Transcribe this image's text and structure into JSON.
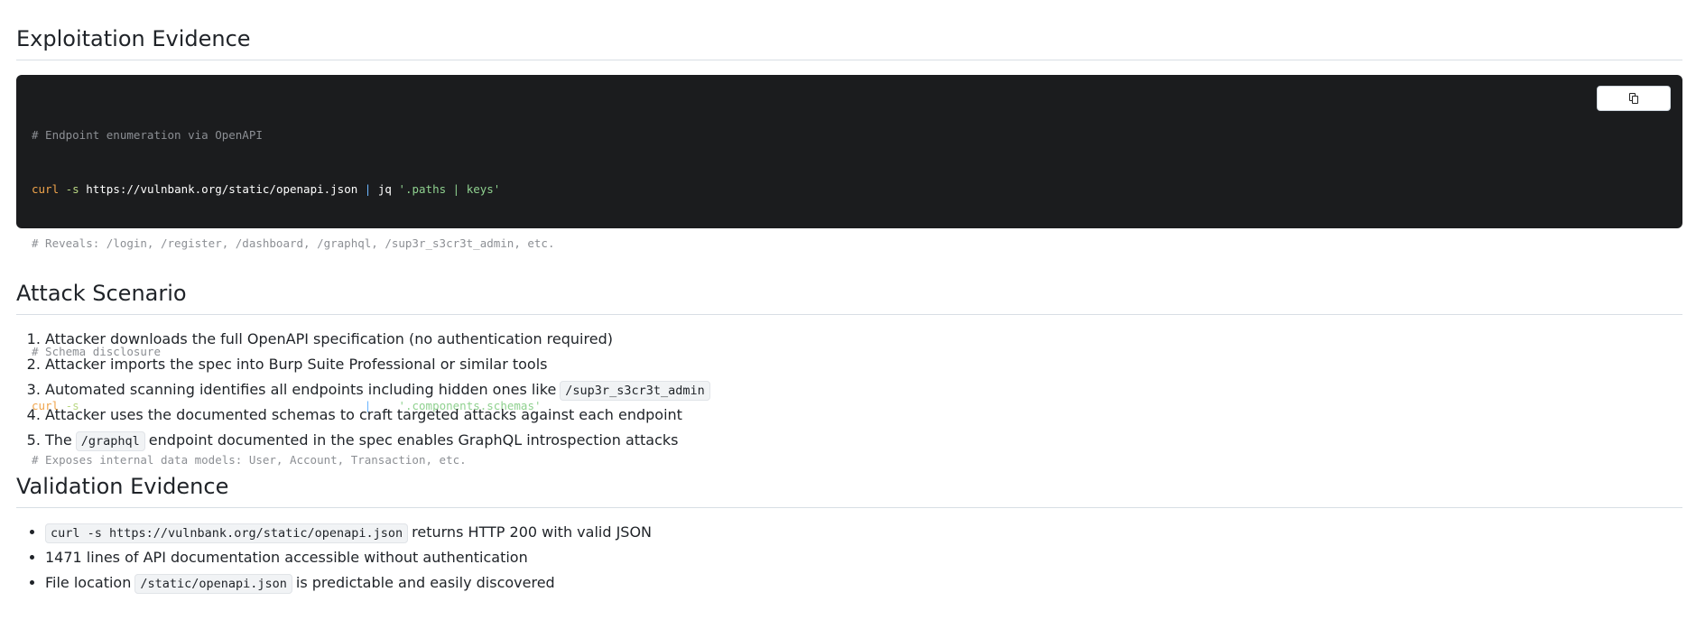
{
  "exploitation": {
    "heading": "Exploitation Evidence",
    "copy_icon": "copy-icon",
    "code": {
      "comment1": "# Endpoint enumeration via OpenAPI",
      "cmd": "curl",
      "flag": "-s",
      "url": "https://vulnbank.org/static/openapi.json",
      "pipe": "|",
      "jq": "jq",
      "str1": "'.paths | keys'",
      "comment2": "# Reveals: /login, /register, /dashboard, /graphql, /sup3r_s3cr3t_admin, etc.",
      "comment3": "# Schema disclosure",
      "str2": "'.components.schemas'",
      "comment4": "# Exposes internal data models: User, Account, Transaction, etc."
    }
  },
  "attack": {
    "heading": "Attack Scenario",
    "steps": {
      "s1": "Attacker downloads the full OpenAPI specification (no authentication required)",
      "s2": "Attacker imports the spec into Burp Suite Professional or similar tools",
      "s3_text": "Automated scanning identifies all endpoints including hidden ones like",
      "s3_code": "/sup3r_s3cr3t_admin",
      "s4": "Attacker uses the documented schemas to craft targeted attacks against each endpoint",
      "s5_pre": "The",
      "s5_code": "/graphql",
      "s5_post": "endpoint documented in the spec enables GraphQL introspection attacks"
    }
  },
  "validation": {
    "heading": "Validation Evidence",
    "items": {
      "i1_code": "curl -s https://vulnbank.org/static/openapi.json",
      "i1_post": "returns HTTP 200 with valid JSON",
      "i2": "1471 lines of API documentation accessible without authentication",
      "i3_pre": "File location",
      "i3_code": "/static/openapi.json",
      "i3_post": "is predictable and easily discovered"
    }
  }
}
